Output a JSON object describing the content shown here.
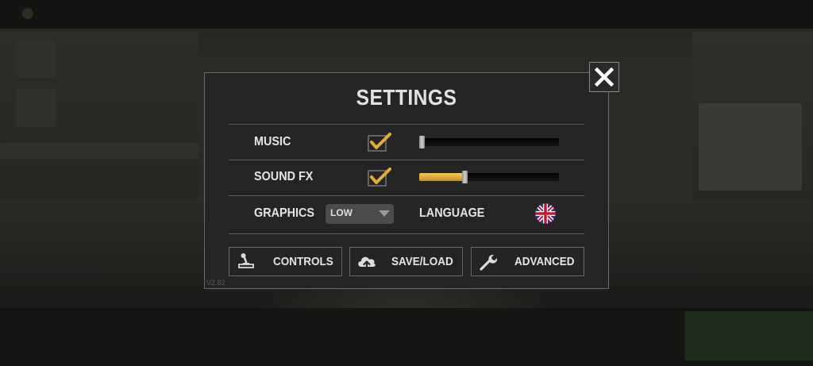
{
  "settings": {
    "title": "SETTINGS",
    "music": {
      "label": "MUSIC",
      "enabled": true,
      "volume_fraction": 0.0
    },
    "sound_fx": {
      "label": "SOUND FX",
      "enabled": true,
      "volume_fraction": 0.32
    },
    "graphics": {
      "label": "GRAPHICS",
      "value": "LOW"
    },
    "language": {
      "label": "LANGUAGE",
      "icon": "uk-flag-icon"
    },
    "buttons": [
      {
        "label": "CONTROLS",
        "icon": "joystick-icon"
      },
      {
        "label": "SAVE/LOAD",
        "icon": "cloud-upload-icon"
      },
      {
        "label": "ADVANCED",
        "icon": "wrench-icon"
      }
    ],
    "version": "V2.82"
  },
  "colors": {
    "accent_gold": "#e6b02c",
    "panel_bg": "#252525",
    "border": "#6a6a6a",
    "text": "#e4e4e4"
  }
}
